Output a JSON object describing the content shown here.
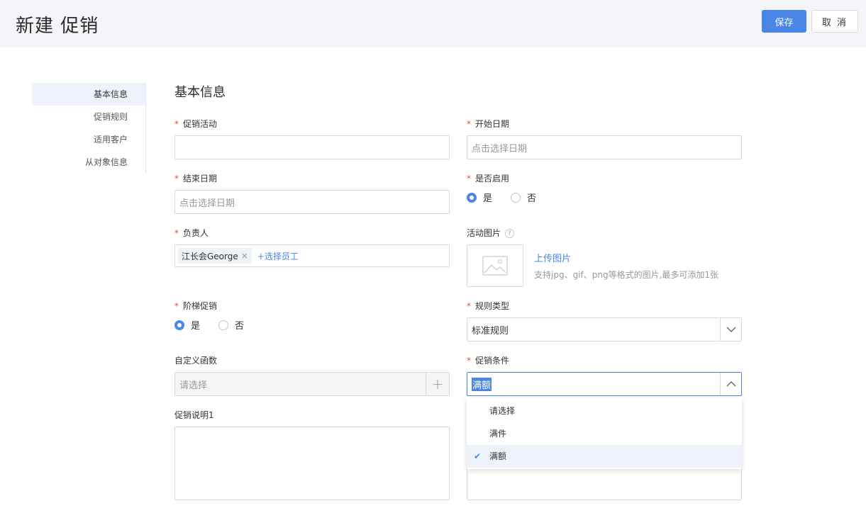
{
  "header": {
    "title": "新建 促销",
    "save_label": "保存",
    "cancel_label": "取 消"
  },
  "side_nav": {
    "items": [
      {
        "label": "基本信息",
        "active": true
      },
      {
        "label": "促销规则"
      },
      {
        "label": "适用客户"
      },
      {
        "label": "从对象信息"
      }
    ]
  },
  "section": {
    "title": "基本信息"
  },
  "fields": {
    "promo_activity": {
      "label": "促销活动",
      "value": ""
    },
    "start_date": {
      "label": "开始日期",
      "placeholder": "点击选择日期"
    },
    "end_date": {
      "label": "结束日期",
      "placeholder": "点击选择日期"
    },
    "enabled": {
      "label": "是否启用",
      "options": [
        "是",
        "否"
      ],
      "selected": "是"
    },
    "owner": {
      "label": "负责人",
      "tag": "江长会George",
      "tag_remove": "×",
      "add_link": "+选择员工"
    },
    "activity_image": {
      "label": "活动图片",
      "help": "?",
      "upload_link": "上传图片",
      "hint": "支持jpg、gif、png等格式的图片,最多可添加1张"
    },
    "tiered": {
      "label": "阶梯促销",
      "options": [
        "是",
        "否"
      ],
      "selected": "是"
    },
    "rule_type": {
      "label": "规则类型",
      "value": "标准规则"
    },
    "custom_function": {
      "label": "自定义函数",
      "placeholder": "请选择",
      "add": "+"
    },
    "promo_condition": {
      "label": "促销条件",
      "value": "满额",
      "options": [
        "请选择",
        "满件",
        "满额"
      ],
      "selected": "满额"
    },
    "promo_desc": {
      "label": "促销说明1"
    }
  },
  "required_mark": "*",
  "check_mark": "✔"
}
